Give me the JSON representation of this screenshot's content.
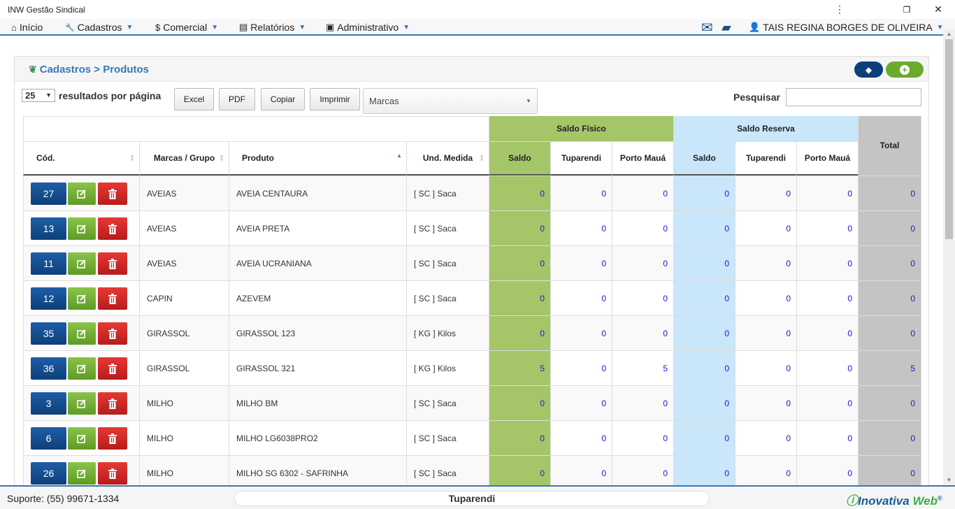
{
  "window": {
    "title": "INW Gestão Sindical",
    "menu_glyph": "⋮",
    "restore_glyph": "❐",
    "close_glyph": "✕"
  },
  "nav": {
    "items": [
      {
        "label": "Início",
        "icon": "home-icon",
        "glyph": "⌂"
      },
      {
        "label": "Cadastros",
        "icon": "wrench-icon",
        "glyph": "🔧"
      },
      {
        "label": "Comercial",
        "icon": "dollar-icon",
        "glyph": "$"
      },
      {
        "label": "Relatórios",
        "icon": "printer-icon",
        "glyph": "▤"
      },
      {
        "label": "Administrativo",
        "icon": "briefcase-icon",
        "glyph": "▣"
      }
    ],
    "user": "TAIS REGINA BORGES DE OLIVEIRA",
    "mail_glyph": "✉",
    "chat_glyph": "▰"
  },
  "breadcrumb": {
    "text": "Cadastros > Produtos"
  },
  "header_buttons": {
    "tags_glyph": "◆",
    "add_glyph": "+"
  },
  "controls": {
    "page_size": "25",
    "per_page_label": "resultados por página",
    "buttons": [
      "Excel",
      "PDF",
      "Copiar",
      "Imprimir"
    ],
    "brand_select": "Marcas",
    "search_label": "Pesquisar",
    "search_value": ""
  },
  "table": {
    "group_headers": {
      "saldo_fisico": "Saldo Físico",
      "saldo_reserva": "Saldo Reserva",
      "total": "Total"
    },
    "columns": {
      "cod": "Cód.",
      "marca": "Marcas / Grupo",
      "produto": "Produto",
      "und": "Und. Medida",
      "saldo": "Saldo",
      "tuparendi": "Tuparendi",
      "porto": "Porto Mauá"
    },
    "rows": [
      {
        "cod": "27",
        "marca": "AVEIAS",
        "produto": "AVEIA CENTAURA",
        "und": "[ SC ] Saca",
        "fis_saldo": "0",
        "fis_tup": "0",
        "fis_porto": "0",
        "res_saldo": "0",
        "res_tup": "0",
        "res_porto": "0",
        "total": "0"
      },
      {
        "cod": "13",
        "marca": "AVEIAS",
        "produto": "AVEIA PRETA",
        "und": "[ SC ] Saca",
        "fis_saldo": "0",
        "fis_tup": "0",
        "fis_porto": "0",
        "res_saldo": "0",
        "res_tup": "0",
        "res_porto": "0",
        "total": "0"
      },
      {
        "cod": "11",
        "marca": "AVEIAS",
        "produto": "AVEIA UCRANIANA",
        "und": "[ SC ] Saca",
        "fis_saldo": "0",
        "fis_tup": "0",
        "fis_porto": "0",
        "res_saldo": "0",
        "res_tup": "0",
        "res_porto": "0",
        "total": "0"
      },
      {
        "cod": "12",
        "marca": "CAPIN",
        "produto": "AZEVEM",
        "und": "[ SC ] Saca",
        "fis_saldo": "0",
        "fis_tup": "0",
        "fis_porto": "0",
        "res_saldo": "0",
        "res_tup": "0",
        "res_porto": "0",
        "total": "0"
      },
      {
        "cod": "35",
        "marca": "GIRASSOL",
        "produto": "GIRASSOL 123",
        "und": "[ KG ] Kilos",
        "fis_saldo": "0",
        "fis_tup": "0",
        "fis_porto": "0",
        "res_saldo": "0",
        "res_tup": "0",
        "res_porto": "0",
        "total": "0"
      },
      {
        "cod": "36",
        "marca": "GIRASSOL",
        "produto": "GIRASSOL 321",
        "und": "[ KG ] Kilos",
        "fis_saldo": "5",
        "fis_tup": "0",
        "fis_porto": "5",
        "res_saldo": "0",
        "res_tup": "0",
        "res_porto": "0",
        "total": "5"
      },
      {
        "cod": "3",
        "marca": "MILHO",
        "produto": "MILHO BM",
        "und": "[ SC ] Saca",
        "fis_saldo": "0",
        "fis_tup": "0",
        "fis_porto": "0",
        "res_saldo": "0",
        "res_tup": "0",
        "res_porto": "0",
        "total": "0"
      },
      {
        "cod": "6",
        "marca": "MILHO",
        "produto": "MILHO LG6038PRO2",
        "und": "[ SC ] Saca",
        "fis_saldo": "0",
        "fis_tup": "0",
        "fis_porto": "0",
        "res_saldo": "0",
        "res_tup": "0",
        "res_porto": "0",
        "total": "0"
      },
      {
        "cod": "26",
        "marca": "MILHO",
        "produto": "MILHO SG 6302 - SAFRINHA",
        "und": "[ SC ] Saca",
        "fis_saldo": "0",
        "fis_tup": "0",
        "fis_porto": "0",
        "res_saldo": "0",
        "res_tup": "0",
        "res_porto": "0",
        "total": "0"
      }
    ]
  },
  "footer": {
    "support": "Suporte: (55) 99671-1334",
    "location": "Tuparendi",
    "brand_a": "Inovativa",
    "brand_b": "Web",
    "brand_mark": "®"
  },
  "colors": {
    "accent": "#3a78b5",
    "saldo_fisico": "#a5c569",
    "saldo_reserva": "#c9e6fa",
    "total": "#c4c4c4",
    "code_btn": "#0d3f7a",
    "edit_btn": "#6aaa2e",
    "delete_btn": "#c62828"
  }
}
